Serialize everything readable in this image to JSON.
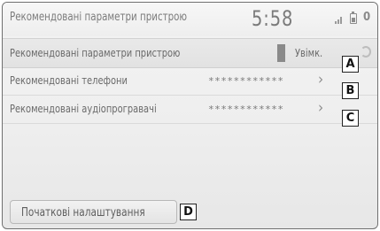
{
  "header": {
    "title": "Рекомендовані параметри пристрою",
    "clock": "5:58",
    "battery_count": "0"
  },
  "rows": [
    {
      "label": "Рекомендовані параметри пристрою",
      "value": "Увімк.",
      "callout": "A"
    },
    {
      "label": "Рекомендовані телефони",
      "value": "************",
      "callout": "B"
    },
    {
      "label": "Рекомендовані аудіопрогравачі",
      "value": "************",
      "callout": "C"
    }
  ],
  "footer": {
    "init_button": "Початкові налаштування",
    "callout": "D"
  },
  "icons": {
    "signal": "signal-icon",
    "battery": "battery-icon",
    "chevron": "chevron-right-icon"
  },
  "colors": {
    "background": "#efefef",
    "text": "#6a6a6a"
  }
}
